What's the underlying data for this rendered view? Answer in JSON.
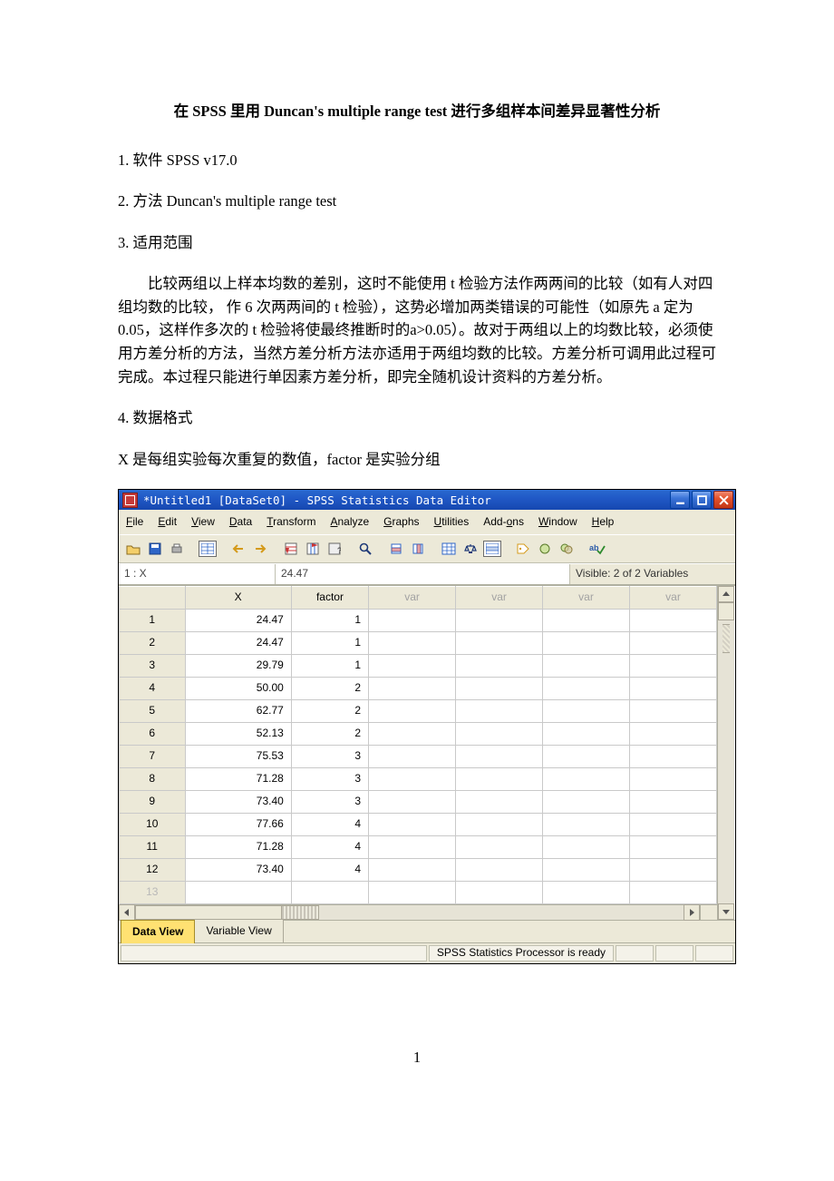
{
  "doc": {
    "title_parts": [
      "在 ",
      "SPSS",
      " 里用 ",
      "Duncan's multiple range test",
      " 进行多组样本间差异显著性分析"
    ],
    "p1": "1. 软件 SPSS v17.0",
    "p2": "2. 方法 Duncan's multiple range test",
    "p3": "3. 适用范围",
    "p4": "比较两组以上样本均数的差别，这时不能使用 t 检验方法作两两间的比较（如有人对四组均数的比较， 作 6 次两两间的 t 检验），这势必增加两类错误的可能性（如原先 a 定为 0.05，这样作多次的 t 检验将使最终推断时的a>0.05）。故对于两组以上的均数比较，必须使用方差分析的方法，当然方差分析方法亦适用于两组均数的比较。方差分析可调用此过程可完成。本过程只能进行单因素方差分析，即完全随机设计资料的方差分析。",
    "p5": "4. 数据格式",
    "p6": "X 是每组实验每次重复的数值，factor 是实验分组",
    "page_number": "1"
  },
  "spss": {
    "title": "*Untitled1 [DataSet0] - SPSS Statistics Data Editor",
    "menu": [
      {
        "u": "F",
        "rest": "ile"
      },
      {
        "u": "E",
        "rest": "dit"
      },
      {
        "u": "V",
        "rest": "iew"
      },
      {
        "u": "D",
        "rest": "ata"
      },
      {
        "u": "T",
        "rest": "ransform"
      },
      {
        "u": "A",
        "rest": "nalyze"
      },
      {
        "u": "G",
        "rest": "raphs"
      },
      {
        "u": "U",
        "rest": "tilities"
      },
      {
        "rest": "Add-",
        "u": "o",
        "tail": "ns"
      },
      {
        "u": "W",
        "rest": "indow"
      },
      {
        "u": "H",
        "rest": "elp"
      }
    ],
    "toolbar_icons": [
      "open",
      "save",
      "print",
      "dataset",
      "undo",
      "redo",
      "gotocase",
      "variables",
      "dialog",
      "find",
      "insertcase",
      "insertvar",
      "splitfile",
      "weight",
      "selectcases",
      "valuelabels",
      "usevarsets",
      "showall",
      "spellcheck"
    ],
    "cell_addr": "1 : X",
    "cell_val": "24.47",
    "visible_text": "Visible: 2 of 2 Variables",
    "columns": [
      "X",
      "factor",
      "var",
      "var",
      "var",
      "var"
    ],
    "rows": [
      {
        "n": "1",
        "X": "24.47",
        "factor": "1"
      },
      {
        "n": "2",
        "X": "24.47",
        "factor": "1"
      },
      {
        "n": "3",
        "X": "29.79",
        "factor": "1"
      },
      {
        "n": "4",
        "X": "50.00",
        "factor": "2"
      },
      {
        "n": "5",
        "X": "62.77",
        "factor": "2"
      },
      {
        "n": "6",
        "X": "52.13",
        "factor": "2"
      },
      {
        "n": "7",
        "X": "75.53",
        "factor": "3"
      },
      {
        "n": "8",
        "X": "71.28",
        "factor": "3"
      },
      {
        "n": "9",
        "X": "73.40",
        "factor": "3"
      },
      {
        "n": "10",
        "X": "77.66",
        "factor": "4"
      },
      {
        "n": "11",
        "X": "71.28",
        "factor": "4"
      },
      {
        "n": "12",
        "X": "73.40",
        "factor": "4"
      },
      {
        "n": "13",
        "X": "",
        "factor": "",
        "dim": true
      }
    ],
    "tabs": {
      "active": "Data View",
      "other": "Variable View"
    },
    "status": "SPSS Statistics Processor is ready"
  }
}
